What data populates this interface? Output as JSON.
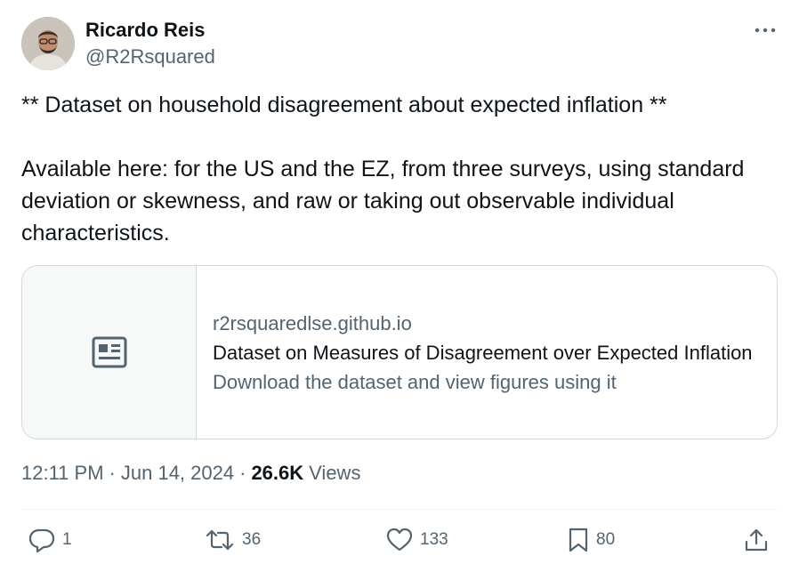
{
  "author": {
    "display_name": "Ricardo Reis",
    "handle": "@R2Rsquared"
  },
  "tweet": {
    "paragraphs": [
      "** Dataset on household disagreement about expected inflation **",
      "Available here: for the US and the EZ, from three surveys, using standard deviation or skewness, and raw or taking out observable individual characteristics."
    ]
  },
  "card": {
    "domain": "r2rsquaredlse.github.io",
    "title": "Dataset on Measures of Disagreement over Expected Inflation",
    "description": "Download the dataset and view figures using it",
    "icon": "article-icon"
  },
  "meta": {
    "time": "12:11 PM",
    "separator": "·",
    "date": "Jun 14, 2024",
    "views_count": "26.6K",
    "views_label": "Views"
  },
  "actions": {
    "replies": "1",
    "reposts": "36",
    "likes": "133",
    "bookmarks": "80"
  },
  "colors": {
    "text": "#0f1419",
    "secondary": "#536471",
    "border": "#cfd9de"
  }
}
